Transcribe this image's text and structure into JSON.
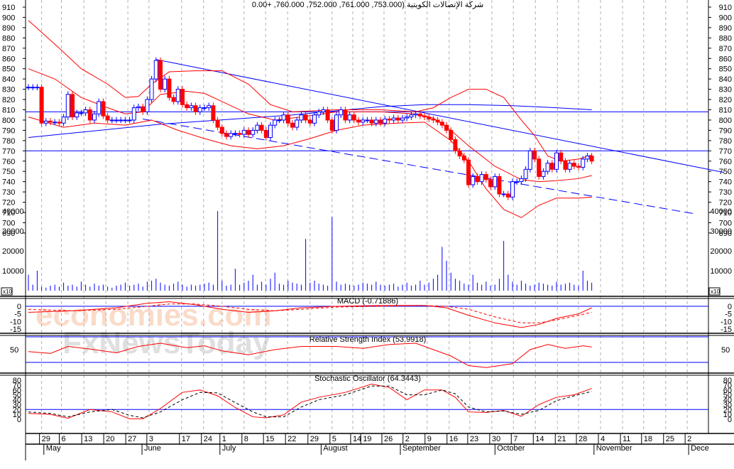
{
  "title": "شركة الإتصالات الكويتية (753.000, 761.000, 752.000, 760.000, +0.00",
  "colors": {
    "up": "#0000ff",
    "down": "#ff0000",
    "line_blue": "#0000ff",
    "line_red": "#ff0000",
    "grid": "#b0b0b0"
  },
  "watermark": [
    "economies.com",
    "FxNewsToday"
  ],
  "chart_data": {
    "type": "candlestick",
    "price_axis": {
      "min": 690,
      "max": 910,
      "step": 10
    },
    "volume_axis": {
      "ticks": [
        10000,
        20000,
        30000,
        40000
      ],
      "multiplier_label": "x10"
    },
    "x_axis": {
      "days": [
        "29",
        "6",
        "13",
        "20",
        "27",
        "3",
        "17",
        "24",
        "1",
        "8",
        "15",
        "22",
        "29",
        "5",
        "14",
        "19",
        "26",
        "2",
        "9",
        "16",
        "23",
        "30",
        "7",
        "14",
        "21",
        "28",
        "4",
        "11",
        "18",
        "25",
        "2"
      ],
      "day_index": [
        3,
        7.5,
        12.6,
        17.6,
        22.6,
        27.4,
        34.8,
        39.8,
        44,
        49,
        53.9,
        58.9,
        64,
        69,
        73.7,
        76,
        80.8,
        85.6,
        90.6,
        95.6,
        100.3,
        105.3,
        110.2,
        115.2,
        120.2,
        125,
        130,
        135,
        139.8,
        144.8,
        149.7
      ],
      "months": [
        "May",
        "June",
        "July",
        "August",
        "September",
        "October",
        "November",
        "Dece"
      ],
      "month_index": [
        4,
        26.3,
        44,
        67,
        85,
        106.5,
        129,
        150.5
      ]
    },
    "closes": [
      832,
      832,
      832,
      797,
      799,
      798,
      798,
      797,
      803,
      825,
      803,
      807,
      807,
      810,
      800,
      806,
      818,
      804,
      800,
      800,
      800,
      800,
      800,
      800,
      812,
      813,
      808,
      820,
      840,
      858,
      830,
      840,
      822,
      818,
      830,
      815,
      812,
      814,
      808,
      812,
      812,
      814,
      800,
      793,
      787,
      784,
      787,
      787,
      786,
      790,
      786,
      790,
      795,
      790,
      783,
      795,
      800,
      800,
      805,
      797,
      793,
      800,
      805,
      800,
      797,
      805,
      808,
      810,
      800,
      790,
      805,
      810,
      800,
      805,
      800,
      798,
      800,
      800,
      797,
      800,
      797,
      801,
      800,
      802,
      800,
      802,
      803,
      805,
      806,
      804,
      803,
      801,
      800,
      798,
      795,
      790,
      781,
      770,
      765,
      761,
      737,
      745,
      740,
      747,
      742,
      735,
      745,
      728,
      728,
      725,
      740,
      740,
      743,
      752,
      770,
      762,
      745,
      750,
      758,
      752,
      768,
      760,
      752,
      758,
      755,
      754,
      762,
      765,
      760
    ],
    "volume": [
      8000,
      3000,
      10000,
      2000,
      1500,
      2500,
      3000,
      2000,
      4000,
      2500,
      3000,
      2000,
      4500,
      3000,
      2000,
      3500,
      2500,
      3000,
      2000,
      1500,
      2500,
      3000,
      4000,
      2500,
      3000,
      3500,
      2000,
      4500,
      5000,
      6000,
      4000,
      3000,
      2500,
      3500,
      4500,
      3000,
      2000,
      3000,
      2500,
      3000,
      3500,
      4000,
      3000,
      40000,
      5000,
      2500,
      3000,
      11000,
      3000,
      4000,
      5000,
      8000,
      3000,
      4500,
      3000,
      6000,
      9000,
      3500,
      3000,
      5000,
      4000,
      3500,
      3000,
      26000,
      4000,
      5000,
      3500,
      3000,
      2500,
      37000,
      4500,
      3000,
      3500,
      3000,
      2500,
      3000,
      4000,
      3500,
      3000,
      4500,
      3000,
      2500,
      3000,
      3500,
      2000,
      3000,
      4000,
      2500,
      3000,
      5000,
      3000,
      4000,
      6000,
      8000,
      22000,
      15000,
      9000,
      6000,
      5000,
      3500,
      3000,
      8000,
      4000,
      3000,
      4500,
      2500,
      3000,
      6000,
      25000,
      8000,
      4500,
      3000,
      5000,
      3500,
      2500,
      3000,
      4000,
      3500,
      3000,
      2500,
      4500,
      3000,
      3500,
      4000,
      3000,
      2500,
      10000,
      5000,
      4000
    ],
    "bollinger": {
      "upper": [
        [
          0,
          897
        ],
        [
          7,
          870
        ],
        [
          12,
          850
        ],
        [
          18,
          835
        ],
        [
          22,
          822
        ],
        [
          25,
          823
        ],
        [
          28,
          835
        ],
        [
          32,
          847
        ],
        [
          38,
          848
        ],
        [
          44,
          848
        ],
        [
          50,
          835
        ],
        [
          55,
          815
        ],
        [
          60,
          808
        ],
        [
          70,
          810
        ],
        [
          80,
          810
        ],
        [
          88,
          808
        ],
        [
          92,
          812
        ],
        [
          96,
          822
        ],
        [
          100,
          830
        ],
        [
          104,
          830
        ],
        [
          108,
          822
        ],
        [
          112,
          800
        ],
        [
          115,
          785
        ],
        [
          118,
          765
        ],
        [
          121,
          760
        ],
        [
          125,
          762
        ],
        [
          128,
          766
        ]
      ],
      "middle": [
        [
          0,
          850
        ],
        [
          6,
          840
        ],
        [
          12,
          822
        ],
        [
          18,
          812
        ],
        [
          22,
          806
        ],
        [
          26,
          808
        ],
        [
          30,
          825
        ],
        [
          36,
          828
        ],
        [
          40,
          826
        ],
        [
          44,
          818
        ],
        [
          50,
          806
        ],
        [
          56,
          800
        ],
        [
          62,
          803
        ],
        [
          70,
          808
        ],
        [
          80,
          808
        ],
        [
          88,
          806
        ],
        [
          92,
          802
        ],
        [
          96,
          790
        ],
        [
          100,
          775
        ],
        [
          106,
          755
        ],
        [
          112,
          742
        ],
        [
          116,
          740
        ],
        [
          120,
          741
        ],
        [
          125,
          743
        ],
        [
          128,
          746
        ]
      ],
      "lower": [
        [
          0,
          803
        ],
        [
          8,
          793
        ],
        [
          15,
          797
        ],
        [
          22,
          795
        ],
        [
          28,
          800
        ],
        [
          34,
          790
        ],
        [
          40,
          782
        ],
        [
          46,
          775
        ],
        [
          52,
          772
        ],
        [
          58,
          775
        ],
        [
          64,
          782
        ],
        [
          70,
          790
        ],
        [
          76,
          795
        ],
        [
          84,
          797
        ],
        [
          90,
          798
        ],
        [
          96,
          780
        ],
        [
          100,
          760
        ],
        [
          104,
          733
        ],
        [
          108,
          713
        ],
        [
          112,
          705
        ],
        [
          116,
          717
        ],
        [
          120,
          724
        ],
        [
          125,
          724
        ],
        [
          128,
          725
        ]
      ]
    },
    "moving_average_long": [
      [
        0,
        783
      ],
      [
        30,
        796
      ],
      [
        60,
        805
      ],
      [
        70,
        809
      ],
      [
        80,
        813
      ],
      [
        90,
        815
      ],
      [
        100,
        815
      ],
      [
        110,
        814
      ],
      [
        120,
        812
      ],
      [
        128,
        810
      ]
    ],
    "trendlines": {
      "descending": [
        [
          29,
          859
        ],
        [
          158,
          749
        ]
      ],
      "descending_dashed": [
        [
          26,
          801
        ],
        [
          151,
          709
        ]
      ],
      "horizontal": [
        808,
        770
      ]
    },
    "macd": {
      "title": "MACD (-0.71886)",
      "ticks": [
        0,
        -5,
        -10,
        -15
      ],
      "line": [
        [
          0,
          -4
        ],
        [
          10,
          -3
        ],
        [
          20,
          -1
        ],
        [
          27,
          2
        ],
        [
          32,
          3
        ],
        [
          38,
          1
        ],
        [
          44,
          -2
        ],
        [
          50,
          -4
        ],
        [
          56,
          -3
        ],
        [
          62,
          -1
        ],
        [
          70,
          0
        ],
        [
          80,
          0.5
        ],
        [
          90,
          0.5
        ],
        [
          95,
          -1
        ],
        [
          100,
          -6
        ],
        [
          106,
          -11
        ],
        [
          112,
          -14
        ],
        [
          116,
          -12
        ],
        [
          120,
          -8
        ],
        [
          125,
          -5
        ],
        [
          128,
          -1
        ]
      ],
      "signal": [
        [
          0,
          -2
        ],
        [
          10,
          -3
        ],
        [
          20,
          -2
        ],
        [
          27,
          0
        ],
        [
          32,
          1.5
        ],
        [
          38,
          1.5
        ],
        [
          44,
          0
        ],
        [
          50,
          -2
        ],
        [
          56,
          -3
        ],
        [
          62,
          -2
        ],
        [
          70,
          -0.5
        ],
        [
          80,
          0
        ],
        [
          90,
          0.5
        ],
        [
          95,
          0
        ],
        [
          100,
          -2
        ],
        [
          106,
          -7
        ],
        [
          112,
          -11
        ],
        [
          116,
          -11
        ],
        [
          120,
          -9
        ],
        [
          125,
          -6
        ],
        [
          128,
          -4
        ]
      ]
    },
    "rsi": {
      "title": "Relative Strength Index (53.9918)",
      "ticks": [
        50
      ],
      "levels": [
        70,
        30
      ],
      "line": [
        [
          0,
          47
        ],
        [
          5,
          44
        ],
        [
          9,
          55
        ],
        [
          15,
          50
        ],
        [
          20,
          45
        ],
        [
          25,
          55
        ],
        [
          30,
          60
        ],
        [
          36,
          53
        ],
        [
          40,
          56
        ],
        [
          44,
          48
        ],
        [
          50,
          42
        ],
        [
          56,
          50
        ],
        [
          62,
          55
        ],
        [
          70,
          55
        ],
        [
          76,
          52
        ],
        [
          82,
          58
        ],
        [
          88,
          60
        ],
        [
          92,
          50
        ],
        [
          96,
          40
        ],
        [
          100,
          25
        ],
        [
          104,
          22
        ],
        [
          110,
          28
        ],
        [
          114,
          50
        ],
        [
          118,
          58
        ],
        [
          122,
          52
        ],
        [
          126,
          56
        ],
        [
          128,
          54
        ]
      ]
    },
    "stochastic": {
      "title": "Stochastic Oscillator (64.3443)",
      "ticks": [
        80,
        70,
        60,
        50,
        40,
        30,
        20,
        10,
        0
      ],
      "level": 20,
      "k": [
        [
          0,
          12
        ],
        [
          5,
          10
        ],
        [
          9,
          2
        ],
        [
          14,
          20
        ],
        [
          19,
          15
        ],
        [
          23,
          1
        ],
        [
          26,
          1
        ],
        [
          30,
          22
        ],
        [
          35,
          55
        ],
        [
          39,
          60
        ],
        [
          43,
          48
        ],
        [
          47,
          24
        ],
        [
          51,
          5
        ],
        [
          54,
          3
        ],
        [
          58,
          9
        ],
        [
          62,
          35
        ],
        [
          66,
          45
        ],
        [
          72,
          55
        ],
        [
          78,
          72
        ],
        [
          82,
          65
        ],
        [
          86,
          40
        ],
        [
          90,
          60
        ],
        [
          94,
          60
        ],
        [
          97,
          45
        ],
        [
          100,
          15
        ],
        [
          104,
          14
        ],
        [
          108,
          18
        ],
        [
          112,
          6
        ],
        [
          116,
          30
        ],
        [
          120,
          45
        ],
        [
          124,
          50
        ],
        [
          128,
          63
        ]
      ],
      "d": [
        [
          0,
          15
        ],
        [
          5,
          12
        ],
        [
          9,
          5
        ],
        [
          14,
          15
        ],
        [
          19,
          20
        ],
        [
          23,
          8
        ],
        [
          26,
          3
        ],
        [
          30,
          15
        ],
        [
          35,
          40
        ],
        [
          39,
          55
        ],
        [
          43,
          54
        ],
        [
          47,
          34
        ],
        [
          51,
          15
        ],
        [
          54,
          5
        ],
        [
          58,
          5
        ],
        [
          62,
          25
        ],
        [
          66,
          40
        ],
        [
          72,
          50
        ],
        [
          78,
          68
        ],
        [
          82,
          68
        ],
        [
          86,
          50
        ],
        [
          90,
          50
        ],
        [
          94,
          60
        ],
        [
          97,
          52
        ],
        [
          100,
          25
        ],
        [
          104,
          15
        ],
        [
          108,
          17
        ],
        [
          112,
          10
        ],
        [
          116,
          18
        ],
        [
          120,
          38
        ],
        [
          124,
          48
        ],
        [
          128,
          57
        ]
      ]
    }
  }
}
